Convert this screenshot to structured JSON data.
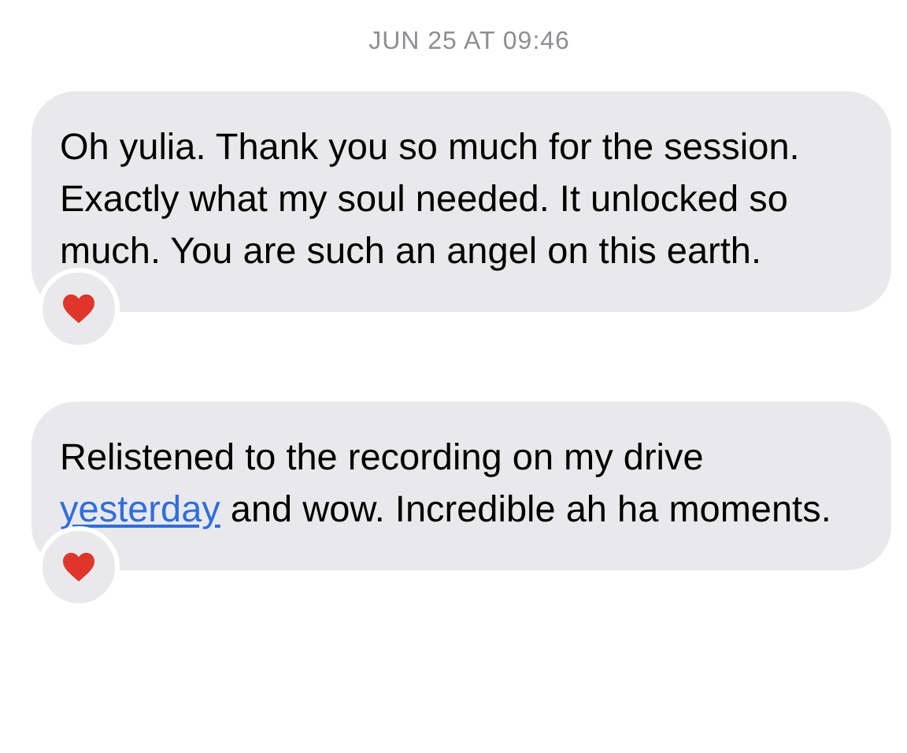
{
  "timestamp": "JUN 25 AT 09:46",
  "messages": [
    {
      "parts": [
        {
          "kind": "text",
          "text": "Oh yulia. Thank you so much for the session. Exactly what my soul needed. It unlocked so much. You are such an angel on this earth."
        }
      ],
      "hearted": true
    },
    {
      "parts": [
        {
          "kind": "text",
          "text": "Relistened to the recording on my drive "
        },
        {
          "kind": "link",
          "text": "yesterday"
        },
        {
          "kind": "text",
          "text": " and wow. Incredible ah ha moments."
        }
      ],
      "hearted": true
    }
  ]
}
